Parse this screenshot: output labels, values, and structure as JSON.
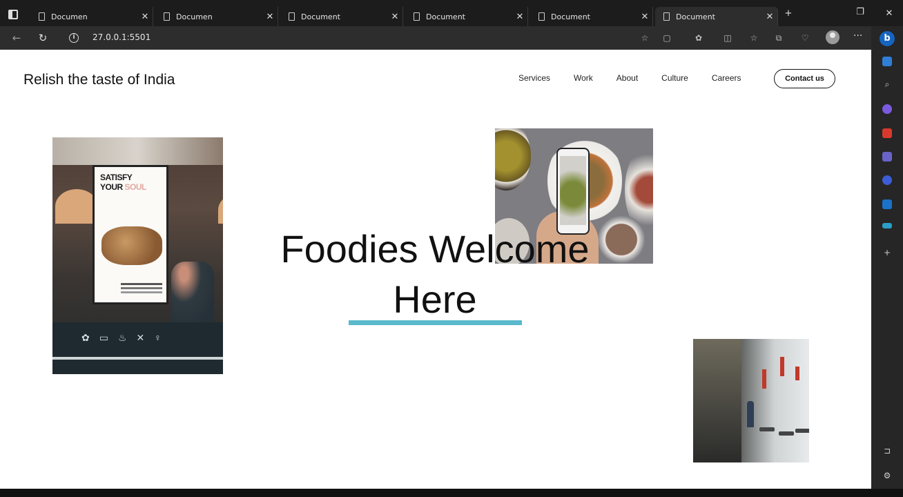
{
  "browser": {
    "tabs": [
      {
        "title": "Documen",
        "active": false
      },
      {
        "title": "Documen",
        "active": false
      },
      {
        "title": "Document",
        "active": false
      },
      {
        "title": "Document",
        "active": false
      },
      {
        "title": "Document",
        "active": false
      },
      {
        "title": "Document",
        "active": true
      }
    ],
    "url": "27.0.0.1:5501"
  },
  "site": {
    "brand": "Relish the taste of India",
    "nav": [
      "Services",
      "Work",
      "About",
      "Culture",
      "Careers"
    ],
    "contact_label": "Contact us",
    "hero_line1": "Foodies Welcome",
    "hero_line2": "Here",
    "accent_color": "#5ab9cc",
    "poster": {
      "line1": "SATISFY",
      "line2a": "YOUR ",
      "line2b": "SOUL"
    }
  }
}
